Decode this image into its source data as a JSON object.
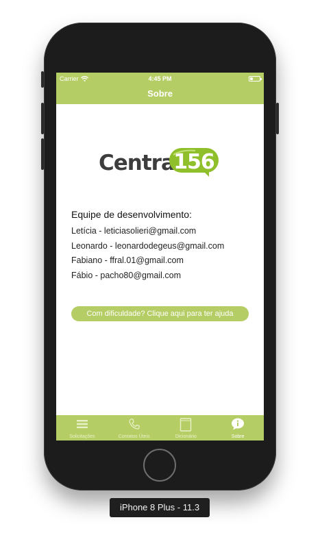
{
  "status_bar": {
    "carrier": "Carrier",
    "time": "4:45 PM",
    "battery_level": 0.3
  },
  "nav": {
    "title": "Sobre"
  },
  "logo": {
    "word": "Central",
    "number": "156"
  },
  "team": {
    "heading": "Equipe de desenvolvimento:",
    "members": [
      "Letícia - leticiasolieri@gmail.com",
      "Leonardo - leonardodegeus@gmail.com",
      "Fabiano - ffral.01@gmail.com",
      "Fábio - pacho80@gmail.com"
    ]
  },
  "help_button": {
    "label": "Com dificuldade? Clique aqui para ter ajuda"
  },
  "tab_bar": {
    "tabs": [
      {
        "label": "Solicitações",
        "icon": "list-icon"
      },
      {
        "label": "Contatos Úteis",
        "icon": "phone-icon"
      },
      {
        "label": "Dicionário",
        "icon": "book-icon"
      },
      {
        "label": "Sobre",
        "icon": "info-bubble-icon"
      }
    ],
    "active_index": 3
  },
  "device_label": "iPhone 8 Plus - 11.3",
  "colors": {
    "accent": "#b5cd65",
    "logo_green": "#8fbf2a",
    "device_body": "#1c1c1c"
  }
}
